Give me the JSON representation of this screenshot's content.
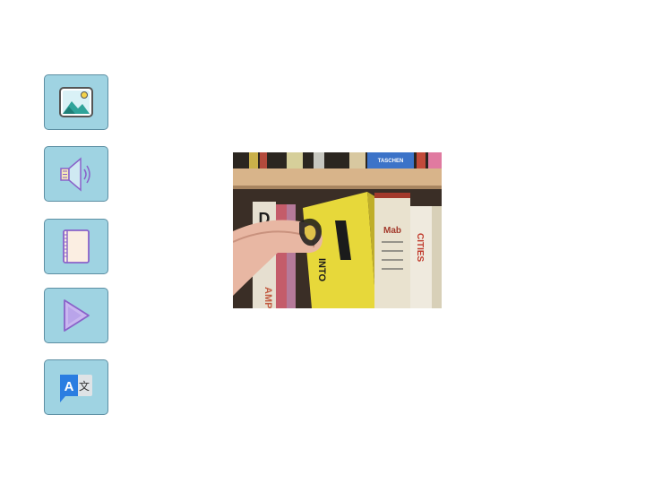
{
  "toolbar": {
    "items": [
      {
        "name": "image",
        "icon": "image-icon"
      },
      {
        "name": "audio",
        "icon": "speaker-icon"
      },
      {
        "name": "book",
        "icon": "book-icon"
      },
      {
        "name": "play",
        "icon": "play-icon"
      },
      {
        "name": "translate",
        "icon": "translate-icon",
        "glyph_latin": "A",
        "glyph_cjk": "文"
      }
    ]
  },
  "photo": {
    "subject": "finger-pulling-book-from-shelf",
    "spine_texts": {
      "top_label": "TASCHEN",
      "yellow_book": "INTO",
      "cream_book": "Mab",
      "left_book": "D",
      "left_book_vertical": "AMP",
      "right_book": "CITIES"
    }
  },
  "colors": {
    "tile_bg": "#9fd3e2",
    "tile_border": "#5d8fa3",
    "icon_stroke": "#8a62c9"
  }
}
